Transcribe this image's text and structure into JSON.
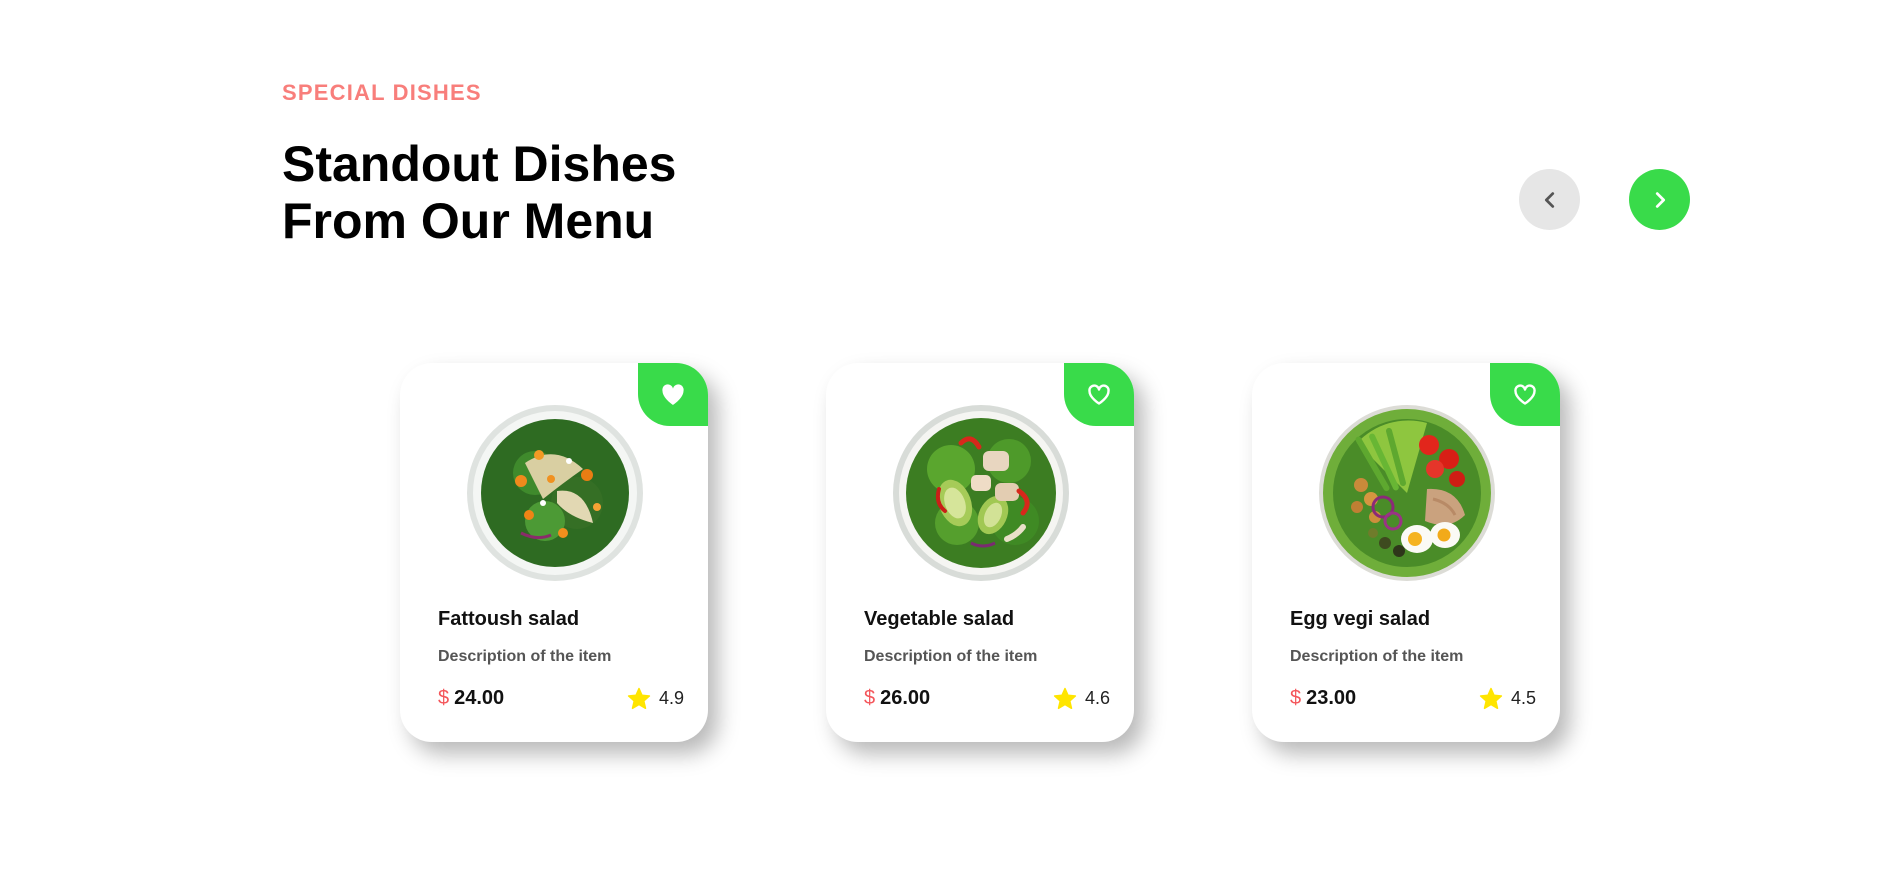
{
  "section": {
    "eyebrow": "SPECIAL DISHES",
    "title": "Standout Dishes From Our Menu"
  },
  "nav": {
    "prev_icon": "chevron-left-icon",
    "next_icon": "chevron-right-icon",
    "prev_color": "#e6e6e6",
    "next_color": "#39db4a"
  },
  "cards": [
    {
      "name": "Fattoush salad",
      "description": "Description of the item",
      "currency": "$",
      "price": "24.00",
      "rating": "4.9",
      "favorite_filled": true
    },
    {
      "name": "Vegetable salad",
      "description": "Description of the item",
      "currency": "$",
      "price": "26.00",
      "rating": "4.6",
      "favorite_filled": false
    },
    {
      "name": "Egg vegi salad",
      "description": "Description of the item",
      "currency": "$",
      "price": "23.00",
      "rating": "4.5",
      "favorite_filled": false
    }
  ],
  "colors": {
    "accent": "#39db4a",
    "eyebrow": "#f87e7b",
    "currency": "#f4555a",
    "star": "#ffe500"
  }
}
